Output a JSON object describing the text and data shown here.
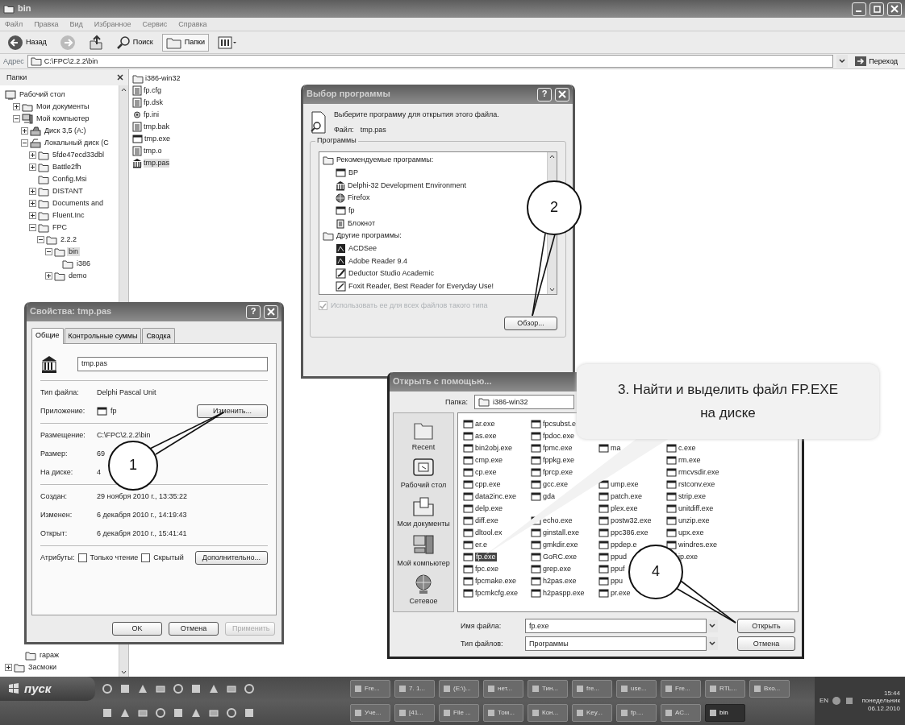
{
  "explorer": {
    "title": "bin",
    "menu": [
      "Файл",
      "Правка",
      "Вид",
      "Избранное",
      "Сервис",
      "Справка"
    ],
    "toolbar": [
      {
        "kind": "back",
        "label": "Назад",
        "pressed": false
      },
      {
        "kind": "forward",
        "pressed": false
      },
      {
        "kind": "up",
        "pressed": false
      },
      {
        "kind": "search",
        "label": "Поиск",
        "pressed": false
      },
      {
        "kind": "folders",
        "label": "Папки",
        "pressed": true
      },
      {
        "kind": "views",
        "pressed": false
      }
    ],
    "address": {
      "label": "Адрес",
      "value": "C:\\FPC\\2.2.2\\bin",
      "go": "Переход"
    },
    "folders_pane": {
      "title": "Папки",
      "tree": [
        {
          "label": "Рабочий стол",
          "kind": "desktop",
          "expandable": false,
          "selected": false,
          "children": [
            {
              "label": "Мои документы",
              "kind": "documents",
              "expandable": true,
              "expanded": false,
              "selected": false
            },
            {
              "label": "Мой компьютер",
              "kind": "computer",
              "expandable": true,
              "expanded": true,
              "selected": false,
              "children": [
                {
                  "label": "Диск 3,5 (A:)",
                  "kind": "floppy",
                  "expandable": true,
                  "expanded": false,
                  "selected": false
                },
                {
                  "label": "Локальный диск (C",
                  "kind": "disk",
                  "expandable": true,
                  "expanded": true,
                  "selected": false,
                  "children": [
                    {
                      "label": "5fde47ecd33dbl",
                      "kind": "folder",
                      "expandable": true,
                      "expanded": false,
                      "selected": false
                    },
                    {
                      "label": "Battle2fh",
                      "kind": "folder",
                      "expandable": true,
                      "expanded": false,
                      "selected": false
                    },
                    {
                      "label": "Config.Msi",
                      "kind": "folder",
                      "expandable": false,
                      "selected": false
                    },
                    {
                      "label": "DISTANT",
                      "kind": "folder",
                      "expandable": true,
                      "expanded": false,
                      "selected": false
                    },
                    {
                      "label": "Documents and",
                      "kind": "folder",
                      "expandable": true,
                      "expanded": false,
                      "selected": false
                    },
                    {
                      "label": "Fluent.Inc",
                      "kind": "folder",
                      "expandable": true,
                      "expanded": false,
                      "selected": false
                    },
                    {
                      "label": "FPC",
                      "kind": "folder",
                      "expandable": true,
                      "expanded": true,
                      "selected": false,
                      "children": [
                        {
                          "label": "2.2.2",
                          "kind": "folder",
                          "expandable": true,
                          "expanded": true,
                          "selected": false,
                          "children": [
                            {
                              "label": "bin",
                              "kind": "folder",
                              "expandable": true,
                              "expanded": true,
                              "selected": true,
                              "children": [
                                {
                                  "label": "i386",
                                  "kind": "folder",
                                  "expandable": false,
                                  "selected": false
                                }
                              ]
                            },
                            {
                              "label": "demo",
                              "kind": "folder",
                              "expandable": true,
                              "expanded": false,
                              "selected": false
                            }
                          ]
                        }
                      ]
                    }
                  ]
                }
              ]
            }
          ]
        }
      ],
      "tree_bottom": [
        {
          "label": "гараж",
          "kind": "folder",
          "expandable": false,
          "selected": false
        },
        {
          "label": "Засмоки",
          "kind": "folder",
          "expandable": true,
          "expanded": false,
          "selected": false
        }
      ]
    },
    "files": [
      {
        "name": "i386-win32",
        "kind": "folder",
        "selected": false
      },
      {
        "name": "fp.cfg",
        "kind": "doc",
        "selected": false
      },
      {
        "name": "fp.dsk",
        "kind": "doc",
        "selected": false
      },
      {
        "name": "fp.ini",
        "kind": "gear",
        "selected": false
      },
      {
        "name": "tmp.bak",
        "kind": "doc",
        "selected": false
      },
      {
        "name": "tmp.exe",
        "kind": "exe",
        "selected": false
      },
      {
        "name": "tmp.o",
        "kind": "doc",
        "selected": false
      },
      {
        "name": "tmp.pas",
        "kind": "pascal",
        "selected": true
      }
    ]
  },
  "properties_dialog": {
    "title": "Свойства: tmp.pas",
    "help": "?",
    "tabs": [
      {
        "label": "Общие",
        "selected": true
      },
      {
        "label": "Контрольные суммы",
        "selected": false
      },
      {
        "label": "Сводка",
        "selected": false
      }
    ],
    "name": "tmp.pas",
    "type_label": "Тип файла:",
    "type_value": "Delphi Pascal Unit",
    "app_label": "Приложение:",
    "app_value": "fp",
    "change_button": "Изменить...",
    "info": [
      {
        "label": "Размещение:",
        "value": "C:\\FPC\\2.2.2\\bin"
      },
      {
        "label": "Размер:",
        "value": "69"
      },
      {
        "label": "На диске:",
        "value": "4"
      }
    ],
    "dates": [
      {
        "label": "Создан:",
        "value": "29 ноября 2010 г., 13:35:22"
      },
      {
        "label": "Изменен:",
        "value": "6 декабря 2010 г., 14:19:43"
      },
      {
        "label": "Открыт:",
        "value": "6 декабря 2010 г., 15:41:41"
      }
    ],
    "attributes_label": "Атрибуты:",
    "attributes": [
      {
        "label": "Только чтение",
        "checked": false
      },
      {
        "label": "Скрытый",
        "checked": false
      }
    ],
    "advanced_button": "Дополнительно...",
    "buttons": [
      {
        "label": "OK",
        "disabled": false
      },
      {
        "label": "Отмена",
        "disabled": false
      },
      {
        "label": "Применить",
        "disabled": true
      }
    ]
  },
  "choose_program_dialog": {
    "title": "Выбор программы",
    "help": "?",
    "prompt": "Выберите программу для открытия этого файла.",
    "file_label": "Файл:",
    "file_value": "tmp.pas",
    "group_label": "Программы",
    "groups": [
      {
        "label": "Рекомендуемые программы:",
        "programs": [
          {
            "name": "BP",
            "kind": "window"
          },
          {
            "name": "Delphi-32 Development Environment",
            "kind": "building"
          },
          {
            "name": "Firefox",
            "kind": "globe"
          },
          {
            "name": "fp",
            "kind": "window"
          },
          {
            "name": "Блокнот",
            "kind": "notepad"
          }
        ]
      },
      {
        "label": "Другие программы:",
        "programs": [
          {
            "name": "ACDSee",
            "kind": "tile"
          },
          {
            "name": "Adobe Reader 9.4",
            "kind": "tile"
          },
          {
            "name": "Deductor Studio Academic",
            "kind": "check"
          },
          {
            "name": "Foxit Reader, Best Reader for Everyday Use!",
            "kind": "pen"
          }
        ]
      }
    ],
    "use_always": {
      "label": "Использовать ее для всех файлов такого типа",
      "checked": true,
      "disabled": true
    },
    "browse_button": "Обзор..."
  },
  "open_with_dialog": {
    "title": "Открыть с помощью...",
    "folder_label": "Папка:",
    "folder_value": "i386-win32",
    "places": [
      {
        "label": "Recent",
        "kind": "recent"
      },
      {
        "label": "Рабочий стол",
        "kind": "desktop"
      },
      {
        "label": "Мои документы",
        "kind": "documents"
      },
      {
        "label": "Мой компьютер",
        "kind": "computer"
      },
      {
        "label": "Сетевое",
        "kind": "network"
      }
    ],
    "columns": [
      [
        {
          "name": "ar.exe",
          "selected": false
        },
        {
          "name": "as.exe",
          "selected": false
        },
        {
          "name": "bin2obj.exe",
          "selected": false
        },
        {
          "name": "cmp.exe",
          "selected": false
        },
        {
          "name": "cp.exe",
          "selected": false
        },
        {
          "name": "cpp.exe",
          "selected": false
        },
        {
          "name": "data2inc.exe",
          "selected": false
        },
        {
          "name": "delp.exe",
          "selected": false
        },
        {
          "name": "diff.exe",
          "selected": false
        },
        {
          "name": "dltool.ex",
          "selected": false
        },
        {
          "name": "er.e",
          "selected": false
        },
        {
          "name": "fp.exe",
          "selected": true
        },
        {
          "name": "fpc.exe",
          "selected": false
        },
        {
          "name": "fpcmake.exe",
          "selected": false
        },
        {
          "name": "fpcmkcfg.exe",
          "selected": false
        }
      ],
      [
        {
          "name": "fpcsubst.e",
          "selected": false
        },
        {
          "name": "fpdoc.exe",
          "selected": false
        },
        {
          "name": "fpmc.exe",
          "selected": false
        },
        {
          "name": "fppkg.exe",
          "selected": false
        },
        {
          "name": "fprcp.exe",
          "selected": false
        },
        {
          "name": "gcc.exe",
          "selected": false
        },
        {
          "name": "gda",
          "selected": false
        },
        null,
        {
          "name": "echo.exe",
          "selected": false
        },
        {
          "name": "ginstall.exe",
          "selected": false
        },
        {
          "name": "gmkdir.exe",
          "selected": false
        },
        {
          "name": "GoRC.exe",
          "selected": false
        },
        {
          "name": "grep.exe",
          "selected": false
        },
        {
          "name": "h2pas.exe",
          "selected": false
        },
        {
          "name": "h2paspp.exe",
          "selected": false
        }
      ],
      [
        null,
        null,
        {
          "name": "ma",
          "selected": false
        },
        null,
        null,
        {
          "name": "ump.exe",
          "selected": false
        },
        {
          "name": "patch.exe",
          "selected": false
        },
        {
          "name": "plex.exe",
          "selected": false
        },
        {
          "name": "postw32.exe",
          "selected": false
        },
        {
          "name": "ppc386.exe",
          "selected": false
        },
        {
          "name": "ppdep.e",
          "selected": false
        },
        {
          "name": "ppud",
          "selected": false
        },
        {
          "name": "ppuf",
          "selected": false
        },
        {
          "name": "ppu",
          "selected": false
        },
        {
          "name": "pr.exe",
          "selected": false
        }
      ],
      [
        null,
        null,
        {
          "name": "c.exe",
          "selected": false
        },
        {
          "name": "rm.exe",
          "selected": false
        },
        {
          "name": "rmcvsdir.exe",
          "selected": false
        },
        {
          "name": "rstconv.exe",
          "selected": false
        },
        {
          "name": "strip.exe",
          "selected": false
        },
        {
          "name": "unitdiff.exe",
          "selected": false
        },
        {
          "name": "unzip.exe",
          "selected": false
        },
        {
          "name": "upx.exe",
          "selected": false
        },
        {
          "name": "windres.exe",
          "selected": false
        },
        {
          "name": "ip.exe",
          "selected": false
        }
      ]
    ],
    "filename_label": "Имя файла:",
    "filename": "fp.exe",
    "filetype_label": "Тип файлов:",
    "filetype": "Программы",
    "open_button": "Открыть",
    "cancel_button": "Отмена"
  },
  "callouts": [
    {
      "kind": "circle",
      "label": "1"
    },
    {
      "kind": "circle",
      "label": "2"
    },
    {
      "kind": "bubble",
      "label": "3. Найти и выделить файл FP.EXE на диске"
    },
    {
      "kind": "circle",
      "label": "4"
    }
  ],
  "taskbar": {
    "start": "пуск",
    "tasks": [
      [
        {
          "label": "Fre...",
          "active": false
        },
        {
          "label": "7. 1...",
          "active": false
        },
        {
          "label": "(E:\\)...",
          "active": false
        },
        {
          "label": "нет...",
          "active": false
        },
        {
          "label": "Тин...",
          "active": false
        },
        {
          "label": "fre...",
          "active": false
        },
        {
          "label": "use...",
          "active": false
        },
        {
          "label": "Fre...",
          "active": false
        },
        {
          "label": "RTL...",
          "active": false
        },
        {
          "label": "Вхо...",
          "active": false
        }
      ],
      [
        {
          "label": "Уче...",
          "active": false
        },
        {
          "label": "[41...",
          "active": false
        },
        {
          "label": "File ...",
          "active": false
        },
        {
          "label": "Том...",
          "active": false
        },
        {
          "label": "Кон...",
          "active": false
        },
        {
          "label": "Key...",
          "active": false
        },
        {
          "label": "fp....",
          "active": false
        },
        {
          "label": "AC...",
          "active": false
        },
        {
          "label": "bin",
          "active": true
        }
      ]
    ],
    "lang": "EN",
    "time": "15:44",
    "day": "понедельник",
    "date": "06.12.2010"
  }
}
